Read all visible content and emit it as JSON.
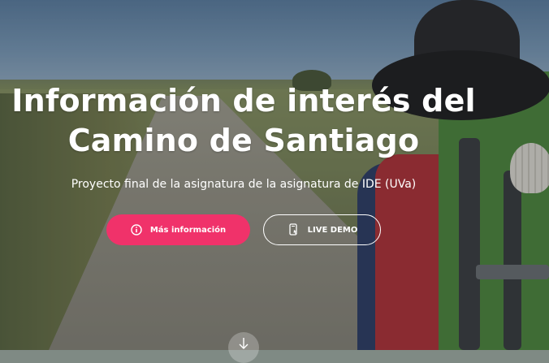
{
  "hero": {
    "title_line1": "Información de interés del",
    "title_line2": "Camino de Santiago",
    "subtitle": "Proyecto final de la asignatura de la asignatura de IDE (UVa)"
  },
  "buttons": {
    "primary_label": "Más información",
    "secondary_label": "LIVE DEMO"
  },
  "colors": {
    "accent": "#f0326a",
    "text": "#ffffff"
  },
  "icons": {
    "primary": "info-icon",
    "secondary": "phone-icon",
    "scroll": "arrow-down-icon"
  }
}
